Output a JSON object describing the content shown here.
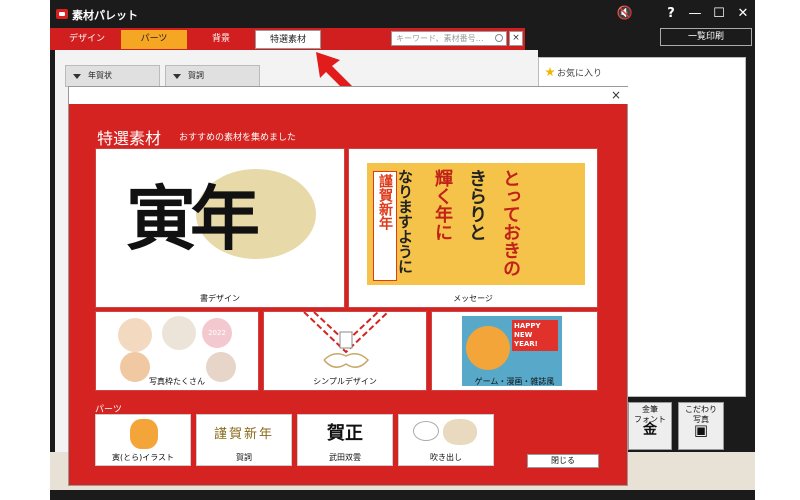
{
  "window": {
    "title": "素材パレット",
    "controls": [
      "🔇",
      "?",
      "—",
      "☐",
      "✕"
    ],
    "print_label": "一覧印刷"
  },
  "tabs": [
    {
      "label": "デザイン"
    },
    {
      "label": "パーツ"
    },
    {
      "label": "背景"
    },
    {
      "label": "特選素材"
    }
  ],
  "search": {
    "placeholder": "キーワード、素材番号…",
    "clear": "×"
  },
  "dropdowns": [
    {
      "label": "年賀状"
    },
    {
      "label": "賀詞"
    }
  ],
  "favorites": {
    "label": "お気に入り"
  },
  "side_buttons": [
    {
      "label": "金筆\nフォント",
      "glyph": "金"
    },
    {
      "label": "こだわり\n写真",
      "glyph": "▣"
    }
  ],
  "modal": {
    "close": "×",
    "title": "特選素材",
    "subtitle": "おすすめの素材を集めました",
    "tiles": [
      {
        "caption": "書デザイン",
        "art": "寅年"
      },
      {
        "caption": "メッセージ",
        "art": [
          "とっておきの",
          "きらりと",
          "輝く年に",
          "なりますように"
        ],
        "badge": "謹賀新年"
      },
      {
        "caption": "写真枠たくさん",
        "badge": "2022"
      },
      {
        "caption": "シンプルデザイン"
      },
      {
        "caption": "ゲーム・漫画・雑誌風",
        "badge": "HAPPY NEW YEAR!"
      }
    ],
    "parts_label": "パーツ",
    "parts": [
      {
        "caption": "寅(とら)イラスト"
      },
      {
        "caption": "賀詞",
        "art": "謹賀新年"
      },
      {
        "caption": "武田双雲",
        "art": "賀正"
      },
      {
        "caption": "吹き出し"
      }
    ],
    "close_button": "閉じる"
  },
  "colors": {
    "brand_red": "#d42320",
    "tab_orange": "#f5a623"
  }
}
